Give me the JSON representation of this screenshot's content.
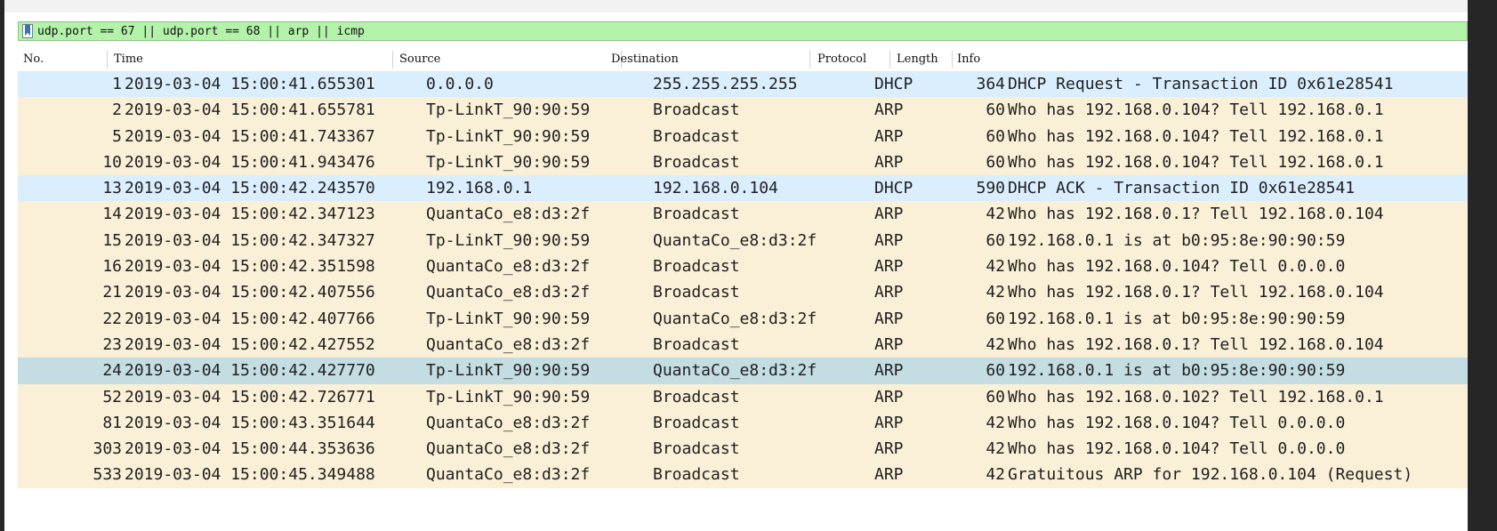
{
  "filter": {
    "text": "udp.port == 67 || udp.port == 68 || arp || icmp"
  },
  "columns": {
    "no": "No.",
    "time": "Time",
    "source": "Source",
    "destination": "Destination",
    "protocol": "Protocol",
    "length": "Length",
    "info": "Info"
  },
  "colors": {
    "filter_bar": "#b2f2a9",
    "dhcp_row": "#daeefe",
    "arp_row": "#faf0d7",
    "selected_row": "#c4dde3"
  },
  "packets": [
    {
      "no": "1",
      "time": "2019-03-04 15:00:41.655301",
      "source": "0.0.0.0",
      "destination": "255.255.255.255",
      "protocol": "DHCP",
      "length": "364",
      "info": "DHCP Request  - Transaction ID 0x61e28541"
    },
    {
      "no": "2",
      "time": "2019-03-04 15:00:41.655781",
      "source": "Tp-LinkT_90:90:59",
      "destination": "Broadcast",
      "protocol": "ARP",
      "length": "60",
      "info": "Who has 192.168.0.104? Tell 192.168.0.1"
    },
    {
      "no": "5",
      "time": "2019-03-04 15:00:41.743367",
      "source": "Tp-LinkT_90:90:59",
      "destination": "Broadcast",
      "protocol": "ARP",
      "length": "60",
      "info": "Who has 192.168.0.104? Tell 192.168.0.1"
    },
    {
      "no": "10",
      "time": "2019-03-04 15:00:41.943476",
      "source": "Tp-LinkT_90:90:59",
      "destination": "Broadcast",
      "protocol": "ARP",
      "length": "60",
      "info": "Who has 192.168.0.104? Tell 192.168.0.1"
    },
    {
      "no": "13",
      "time": "2019-03-04 15:00:42.243570",
      "source": "192.168.0.1",
      "destination": "192.168.0.104",
      "protocol": "DHCP",
      "length": "590",
      "info": "DHCP ACK      - Transaction ID 0x61e28541"
    },
    {
      "no": "14",
      "time": "2019-03-04 15:00:42.347123",
      "source": "QuantaCo_e8:d3:2f",
      "destination": "Broadcast",
      "protocol": "ARP",
      "length": "42",
      "info": "Who has 192.168.0.1? Tell 192.168.0.104"
    },
    {
      "no": "15",
      "time": "2019-03-04 15:00:42.347327",
      "source": "Tp-LinkT_90:90:59",
      "destination": "QuantaCo_e8:d3:2f",
      "protocol": "ARP",
      "length": "60",
      "info": "192.168.0.1 is at b0:95:8e:90:90:59"
    },
    {
      "no": "16",
      "time": "2019-03-04 15:00:42.351598",
      "source": "QuantaCo_e8:d3:2f",
      "destination": "Broadcast",
      "protocol": "ARP",
      "length": "42",
      "info": "Who has 192.168.0.104? Tell 0.0.0.0"
    },
    {
      "no": "21",
      "time": "2019-03-04 15:00:42.407556",
      "source": "QuantaCo_e8:d3:2f",
      "destination": "Broadcast",
      "protocol": "ARP",
      "length": "42",
      "info": "Who has 192.168.0.1? Tell 192.168.0.104"
    },
    {
      "no": "22",
      "time": "2019-03-04 15:00:42.407766",
      "source": "Tp-LinkT_90:90:59",
      "destination": "QuantaCo_e8:d3:2f",
      "protocol": "ARP",
      "length": "60",
      "info": "192.168.0.1 is at b0:95:8e:90:90:59"
    },
    {
      "no": "23",
      "time": "2019-03-04 15:00:42.427552",
      "source": "QuantaCo_e8:d3:2f",
      "destination": "Broadcast",
      "protocol": "ARP",
      "length": "42",
      "info": "Who has 192.168.0.1? Tell 192.168.0.104"
    },
    {
      "no": "24",
      "time": "2019-03-04 15:00:42.427770",
      "source": "Tp-LinkT_90:90:59",
      "destination": "QuantaCo_e8:d3:2f",
      "protocol": "ARP",
      "length": "60",
      "info": "192.168.0.1 is at b0:95:8e:90:90:59",
      "selected": true
    },
    {
      "no": "52",
      "time": "2019-03-04 15:00:42.726771",
      "source": "Tp-LinkT_90:90:59",
      "destination": "Broadcast",
      "protocol": "ARP",
      "length": "60",
      "info": "Who has 192.168.0.102? Tell 192.168.0.1"
    },
    {
      "no": "81",
      "time": "2019-03-04 15:00:43.351644",
      "source": "QuantaCo_e8:d3:2f",
      "destination": "Broadcast",
      "protocol": "ARP",
      "length": "42",
      "info": "Who has 192.168.0.104? Tell 0.0.0.0"
    },
    {
      "no": "303",
      "time": "2019-03-04 15:00:44.353636",
      "source": "QuantaCo_e8:d3:2f",
      "destination": "Broadcast",
      "protocol": "ARP",
      "length": "42",
      "info": "Who has 192.168.0.104? Tell 0.0.0.0"
    },
    {
      "no": "533",
      "time": "2019-03-04 15:00:45.349488",
      "source": "QuantaCo_e8:d3:2f",
      "destination": "Broadcast",
      "protocol": "ARP",
      "length": "42",
      "info": "Gratuitous ARP for 192.168.0.104 (Request)"
    }
  ]
}
